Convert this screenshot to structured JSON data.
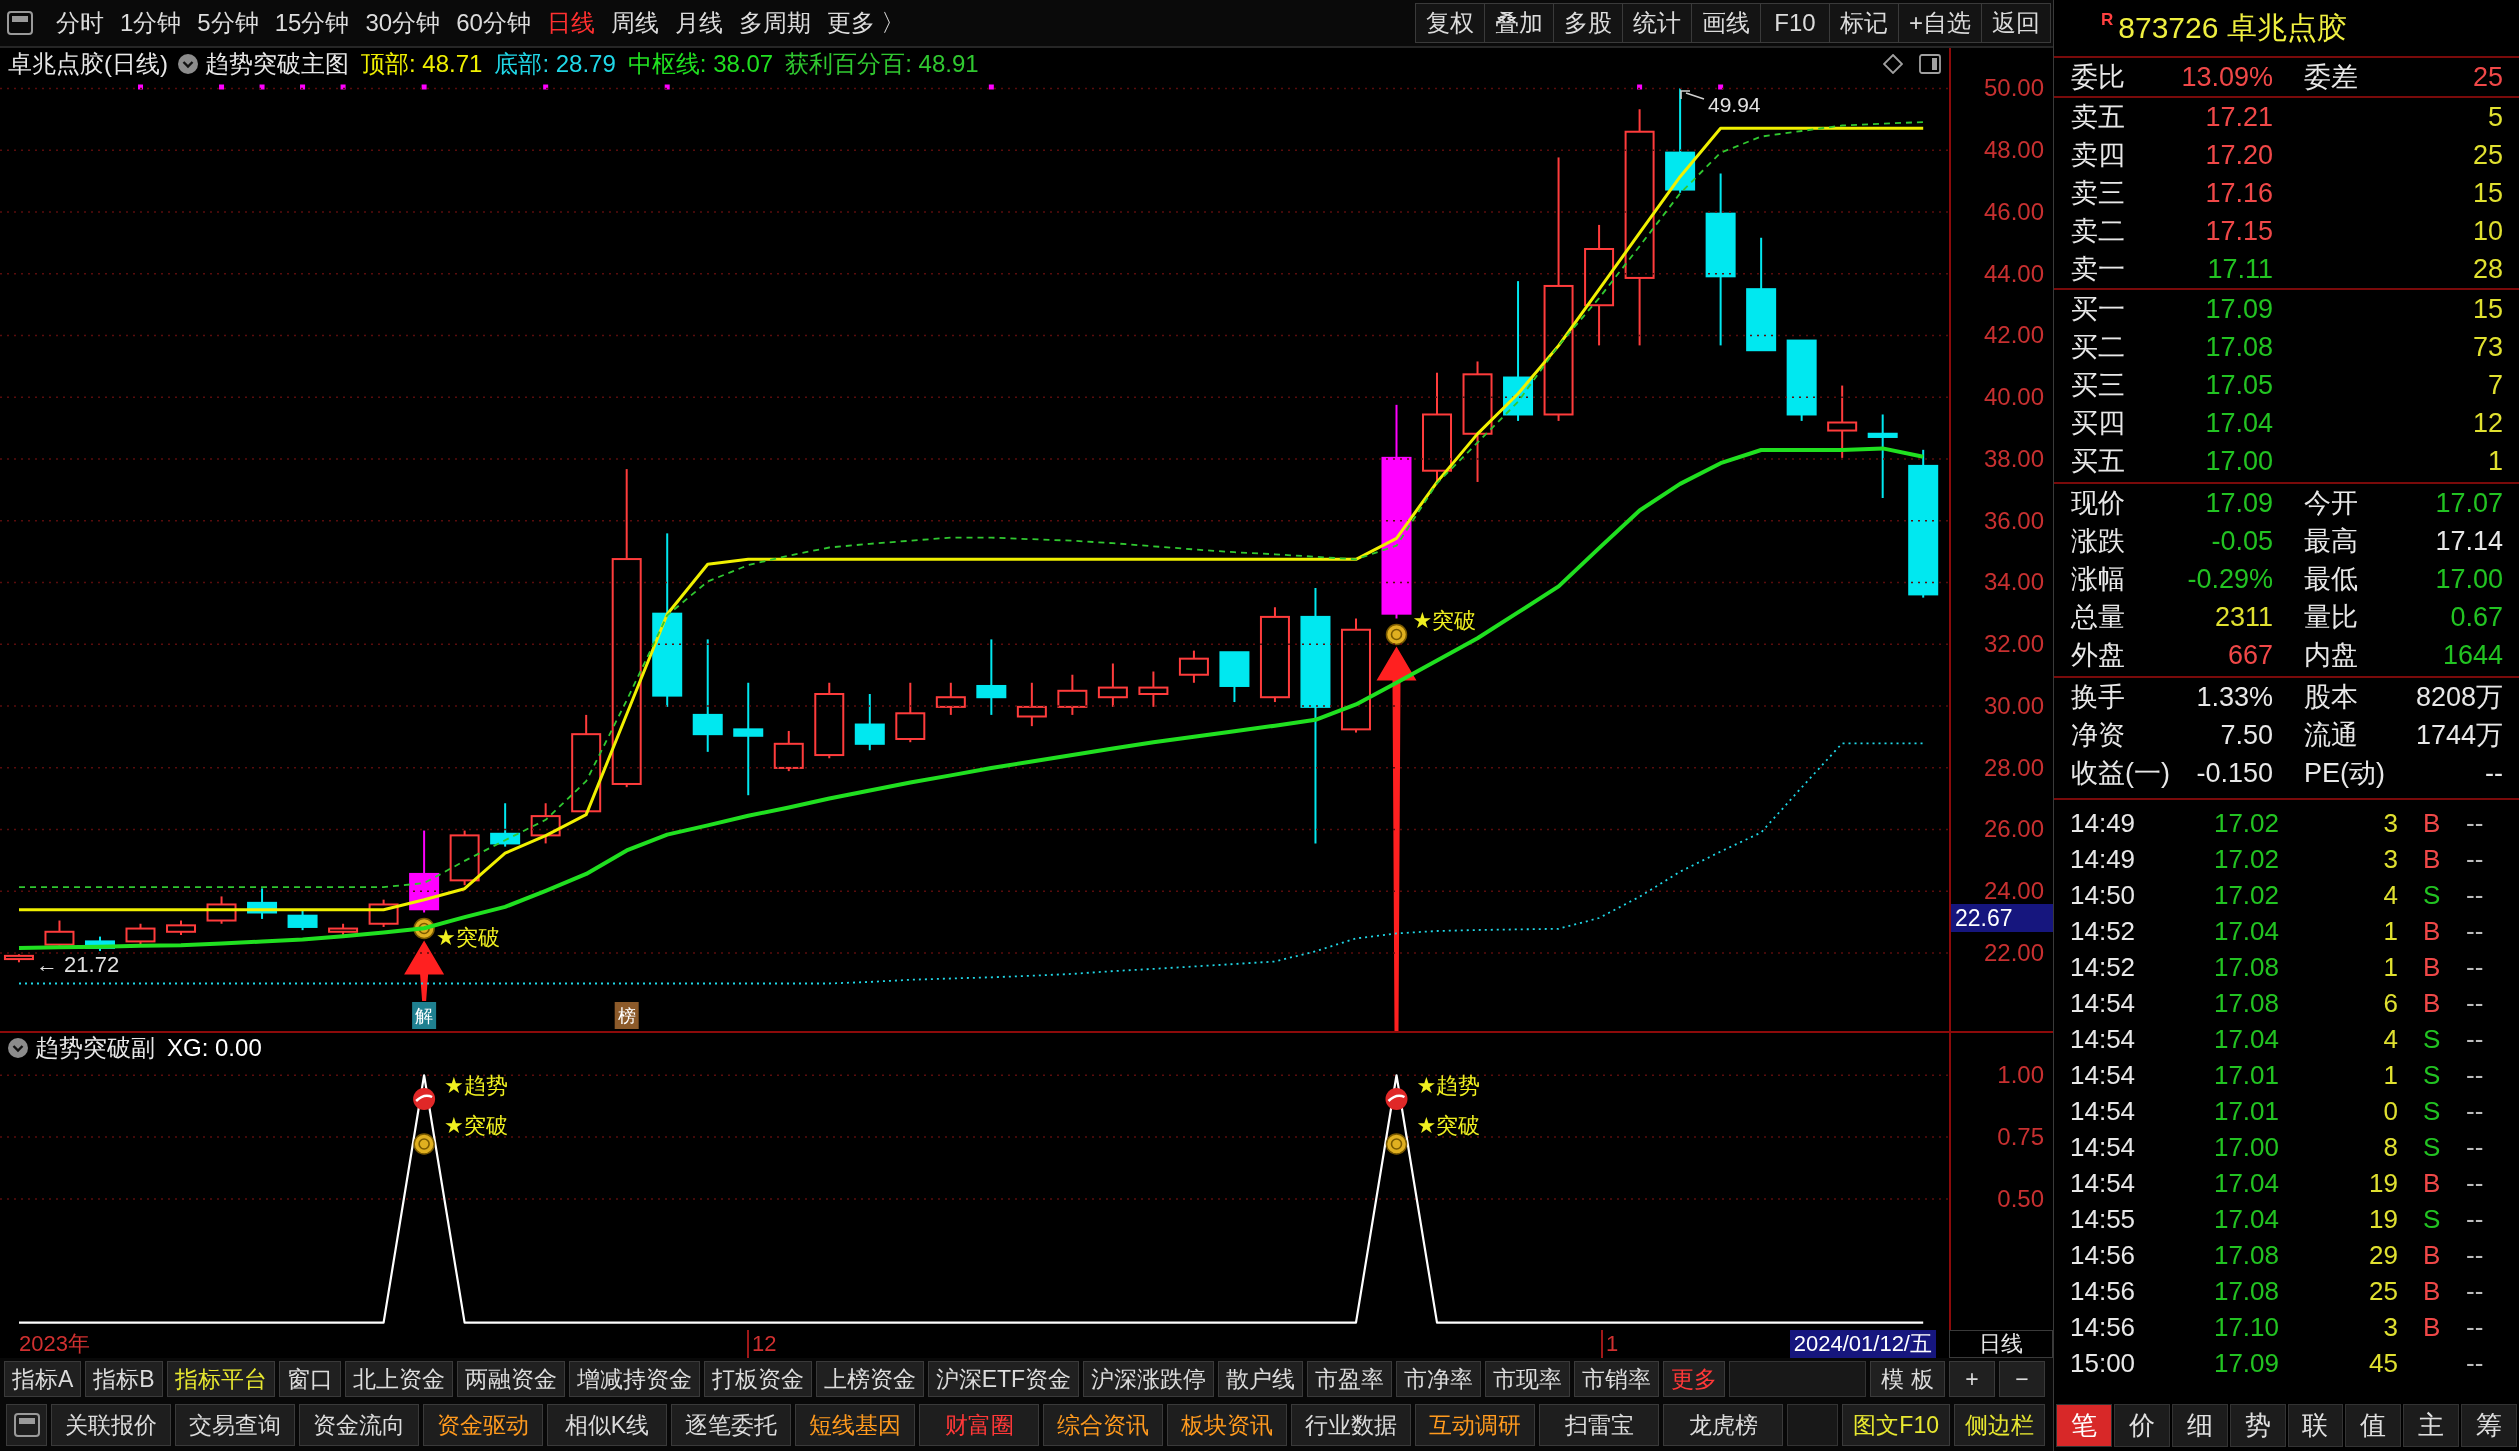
{
  "toolbar": {
    "periods": [
      {
        "label": "分时",
        "selected": false
      },
      {
        "label": "1分钟",
        "selected": false
      },
      {
        "label": "5分钟",
        "selected": false
      },
      {
        "label": "15分钟",
        "selected": false
      },
      {
        "label": "30分钟",
        "selected": false
      },
      {
        "label": "60分钟",
        "selected": false
      },
      {
        "label": "日线",
        "selected": true
      },
      {
        "label": "周线",
        "selected": false
      },
      {
        "label": "月线",
        "selected": false
      },
      {
        "label": "多周期",
        "selected": false
      },
      {
        "label": "更多 〉",
        "selected": false
      }
    ],
    "actions": [
      "复权",
      "叠加",
      "多股",
      "统计",
      "画线",
      "F10",
      "标记",
      "+自选",
      "返回"
    ]
  },
  "main_chart": {
    "title": "卓兆点胶(日线)",
    "indicator": "趋势突破主图",
    "readouts": [
      ": 48.71",
      ": 28.79",
      ": 38.07",
      ": 48.91"
    ],
    "high_label": "49.94",
    "low_label": "← 21.72",
    "signals": [
      "★突破",
      "★突破"
    ],
    "tags": [
      {
        "label": "解",
        "color": "#1f8090"
      },
      {
        "label": "榜",
        "color": "#8c5a2a"
      }
    ],
    "price_tag": "22.67",
    "chart_data": {
      "type": "line",
      "series": [
        {
          "name": "顶部",
          "color": "#f0f000",
          "values": [
            23.4,
            23.4,
            23.4,
            23.4,
            23.4,
            23.4,
            23.4,
            23.4,
            23.4,
            23.4,
            23.72,
            24.08,
            25.23,
            25.8,
            26.48,
            29.73,
            32.97,
            34.59,
            34.75,
            34.75,
            34.75,
            34.75,
            34.75,
            34.75,
            34.75,
            34.75,
            34.75,
            34.75,
            34.75,
            34.75,
            34.75,
            34.75,
            34.75,
            34.75,
            35.43,
            37.25,
            38.81,
            40.11,
            41.67,
            43.49,
            45.32,
            47.14,
            48.71,
            48.71,
            48.71,
            48.71,
            48.71,
            48.71
          ]
        },
        {
          "name": "底部",
          "color": "#20d8e8",
          "line_style": "dotted",
          "values": [
            21.01,
            21.01,
            21.01,
            21.01,
            21.01,
            21.01,
            21.01,
            21.01,
            21.01,
            21.01,
            21.01,
            21.01,
            21.01,
            21.01,
            21.01,
            21.01,
            21.01,
            21.01,
            21.01,
            21.01,
            21.01,
            21.06,
            21.13,
            21.17,
            21.21,
            21.26,
            21.32,
            21.41,
            21.48,
            21.56,
            21.64,
            21.72,
            22.05,
            22.47,
            22.63,
            22.71,
            22.74,
            22.76,
            22.78,
            23.13,
            23.82,
            24.63,
            25.28,
            25.9,
            27.36,
            28.79,
            28.79,
            28.79
          ]
        },
        {
          "name": "中枢线",
          "color": "#20e020",
          "values": [
            22.16,
            22.18,
            22.2,
            22.23,
            22.25,
            22.3,
            22.37,
            22.43,
            22.54,
            22.66,
            22.8,
            23.16,
            23.49,
            24.01,
            24.56,
            25.32,
            25.83,
            26.13,
            26.44,
            26.71,
            27.0,
            27.26,
            27.52,
            27.75,
            27.99,
            28.2,
            28.41,
            28.62,
            28.82,
            29.0,
            29.18,
            29.36,
            29.55,
            30.05,
            30.75,
            31.47,
            32.19,
            33.03,
            33.87,
            35.11,
            36.33,
            37.19,
            37.86,
            38.29,
            38.29,
            38.29,
            38.34,
            38.07
          ]
        },
        {
          "name": "获利百分百",
          "color": "#30c830",
          "line_style": "dashed",
          "values": [
            24.13,
            24.13,
            24.13,
            24.13,
            24.13,
            24.13,
            24.13,
            24.13,
            24.13,
            24.13,
            24.26,
            24.98,
            25.65,
            26.31,
            27.56,
            30.18,
            32.93,
            34.03,
            34.56,
            34.87,
            35.13,
            35.25,
            35.35,
            35.45,
            35.45,
            35.4,
            35.35,
            35.27,
            35.17,
            35.07,
            34.98,
            34.91,
            34.83,
            34.75,
            35.19,
            37.21,
            38.53,
            39.85,
            41.67,
            43.21,
            44.89,
            46.6,
            47.92,
            48.44,
            48.62,
            48.8,
            48.86,
            48.91
          ]
        }
      ],
      "ylim": [
        19.47,
        51.31
      ],
      "grid": true,
      "yticks": [
        {
          "value": 50,
          "label": "50.00"
        },
        {
          "value": 48,
          "label": "48.00"
        },
        {
          "value": 46,
          "label": "46.00"
        },
        {
          "value": 44,
          "label": "44.00"
        },
        {
          "value": 42,
          "label": "42.00"
        },
        {
          "value": 40,
          "label": "40.00"
        },
        {
          "value": 38,
          "label": "38.00"
        },
        {
          "value": 36,
          "label": "36.00"
        },
        {
          "value": 34,
          "label": "34.00"
        },
        {
          "value": 32,
          "label": "32.00"
        },
        {
          "value": 30,
          "label": "30.00"
        },
        {
          "value": 28,
          "label": "28.00"
        },
        {
          "value": 26,
          "label": "26.00"
        },
        {
          "value": 24,
          "label": "24.00"
        },
        {
          "value": 22,
          "label": "22.00"
        }
      ]
    }
  },
  "sub_chart": {
    "indicator": "趋势突破副",
    "readout": ": 0.00",
    "signals": [
      {
        "trend": "★趋势",
        "breakout": "★突破"
      },
      {
        "trend": "★趋势",
        "breakout": "★突破"
      }
    ],
    "chart_data": {
      "type": "line",
      "series": [
        {
          "name": "XG",
          "color": "#ffffff",
          "values": [
            0,
            0,
            0,
            0,
            0,
            0,
            0,
            0,
            0,
            0,
            1,
            0,
            0,
            0,
            0,
            0,
            0,
            0,
            0,
            0,
            0,
            0,
            0,
            0,
            0,
            0,
            0,
            0,
            0,
            0,
            0,
            0,
            0,
            0,
            1,
            0,
            0,
            0,
            0,
            0,
            0,
            0,
            0,
            0,
            0,
            0,
            0,
            0
          ]
        }
      ],
      "ylim": [
        -0.03,
        1.171
      ],
      "grid": true,
      "yticks": [
        {
          "value": 1,
          "label": "1.00"
        },
        {
          "value": 0.75,
          "label": "0.75"
        },
        {
          "value": 0.5,
          "label": "0.50"
        }
      ]
    }
  },
  "date_axis": {
    "labels": [
      "2023年",
      "12",
      "1"
    ],
    "cursor_date": "2024/01/12/五",
    "period": "日线"
  },
  "indicator_tabs": [
    {
      "label": "指标A",
      "color": "#dcdcdc"
    },
    {
      "label": "指标B",
      "color": "#dcdcdc"
    },
    {
      "label": "指标平台",
      "color": "#e8e830"
    },
    {
      "label": "窗口",
      "color": "#dcdcdc"
    },
    {
      "label": "北上资金",
      "color": "#dcdcdc"
    },
    {
      "label": "两融资金",
      "color": "#dcdcdc"
    },
    {
      "label": "增减持资金",
      "color": "#dcdcdc"
    },
    {
      "label": "打板资金",
      "color": "#dcdcdc"
    },
    {
      "label": "上榜资金",
      "color": "#dcdcdc"
    },
    {
      "label": "沪深ETF资金",
      "color": "#dcdcdc"
    },
    {
      "label": "沪深涨跌停",
      "color": "#dcdcdc"
    },
    {
      "label": "散户线",
      "color": "#dcdcdc"
    },
    {
      "label": "市盈率",
      "color": "#dcdcdc"
    },
    {
      "label": "市净率",
      "color": "#dcdcdc"
    },
    {
      "label": "市现率",
      "color": "#dcdcdc"
    },
    {
      "label": "市销率",
      "color": "#dcdcdc"
    },
    {
      "label": "更多",
      "color": "#ff3838"
    }
  ],
  "indicator_tools": [
    "模 板",
    "+",
    "−"
  ],
  "function_tabs": [
    {
      "label": "关联报价",
      "color": "#dcdcdc"
    },
    {
      "label": "交易查询",
      "color": "#dcdcdc"
    },
    {
      "label": "资金流向",
      "color": "#dcdcdc"
    },
    {
      "label": "资金驱动",
      "color": "#ff9a1e"
    },
    {
      "label": "相似K线",
      "color": "#dcdcdc"
    },
    {
      "label": "逐笔委托",
      "color": "#dcdcdc"
    },
    {
      "label": "短线基因",
      "color": "#ff9a1e"
    },
    {
      "label": "财富圈",
      "color": "#ff3838"
    },
    {
      "label": "综合资讯",
      "color": "#ff9a1e"
    },
    {
      "label": "板块资讯",
      "color": "#ff9a1e"
    },
    {
      "label": "行业数据",
      "color": "#dcdcdc"
    },
    {
      "label": "互动调研",
      "color": "#ff9a1e"
    },
    {
      "label": "扫雷宝",
      "color": "#dcdcdc"
    },
    {
      "label": "龙虎榜",
      "color": "#dcdcdc"
    }
  ],
  "side_tabs": [
    {
      "label": "图文F10",
      "color": "#e8e830"
    },
    {
      "label": "侧边栏",
      "color": "#e8e830"
    }
  ],
  "quote_panel": {
    "flag": "R",
    "title": "873726 卓兆点胶",
    "ratio": [
      {
        "label": "委比",
        "value": "13.09%",
        "color": "#f04848"
      },
      {
        "label": "委差",
        "value": "25",
        "color": "#f04848"
      }
    ],
    "asks": [
      {
        "label": "卖五",
        "price": "17.21",
        "volume": "5",
        "color": "#f04848"
      },
      {
        "label": "卖四",
        "price": "17.20",
        "volume": "25",
        "color": "#f04848"
      },
      {
        "label": "卖三",
        "price": "17.16",
        "volume": "15",
        "color": "#f04848"
      },
      {
        "label": "卖二",
        "price": "17.15",
        "volume": "10",
        "color": "#f04848"
      },
      {
        "label": "卖一",
        "price": "17.11",
        "volume": "28",
        "color": "#22c322"
      }
    ],
    "bids": [
      {
        "label": "买一",
        "price": "17.09",
        "volume": "15",
        "color": "#22c322"
      },
      {
        "label": "买二",
        "price": "17.08",
        "volume": "73",
        "color": "#22c322"
      },
      {
        "label": "买三",
        "price": "17.05",
        "volume": "7",
        "color": "#22c322"
      },
      {
        "label": "买四",
        "price": "17.04",
        "volume": "12",
        "color": "#22c322"
      },
      {
        "label": "买五",
        "price": "17.00",
        "volume": "1",
        "color": "#22c322"
      }
    ],
    "stats": [
      {
        "label": "现价",
        "value": "17.09",
        "color": "#22c322"
      },
      {
        "label": "今开",
        "value": "17.07",
        "color": "#22c322"
      },
      {
        "label": "涨跌",
        "value": "-0.05",
        "color": "#22c322"
      },
      {
        "label": "最高",
        "value": "17.14",
        "color": "#e8e8e8"
      },
      {
        "label": "涨幅",
        "value": "-0.29%",
        "color": "#22c322"
      },
      {
        "label": "最低",
        "value": "17.00",
        "color": "#22c322"
      },
      {
        "label": "总量",
        "value": "2311",
        "color": "#e0e030"
      },
      {
        "label": "量比",
        "value": "0.67",
        "color": "#22c322"
      },
      {
        "label": "外盘",
        "value": "667",
        "color": "#f04848"
      },
      {
        "label": "内盘",
        "value": "1644",
        "color": "#22c322"
      }
    ],
    "fundamentals": [
      {
        "label": "换手",
        "value": "1.33%"
      },
      {
        "label": "股本",
        "value": "8208万"
      },
      {
        "label": "净资",
        "value": "7.50"
      },
      {
        "label": "流通",
        "value": "1744万"
      },
      {
        "label": "收益(一)",
        "value": "-0.150"
      },
      {
        "label": "PE(动)",
        "value": "--"
      }
    ],
    "ticks": [
      {
        "time": "14:49",
        "price": "17.02",
        "volume": "3",
        "side": "B",
        "color": "#f04848",
        "change": "--"
      },
      {
        "time": "14:49",
        "price": "17.02",
        "volume": "3",
        "side": "B",
        "color": "#f04848",
        "change": "--"
      },
      {
        "time": "14:50",
        "price": "17.02",
        "volume": "4",
        "side": "S",
        "color": "#22c322",
        "change": "--"
      },
      {
        "time": "14:52",
        "price": "17.04",
        "volume": "1",
        "side": "B",
        "color": "#f04848",
        "change": "--"
      },
      {
        "time": "14:52",
        "price": "17.08",
        "volume": "1",
        "side": "B",
        "color": "#f04848",
        "change": "--"
      },
      {
        "time": "14:54",
        "price": "17.08",
        "volume": "6",
        "side": "B",
        "color": "#f04848",
        "change": "--"
      },
      {
        "time": "14:54",
        "price": "17.04",
        "volume": "4",
        "side": "S",
        "color": "#22c322",
        "change": "--"
      },
      {
        "time": "14:54",
        "price": "17.01",
        "volume": "1",
        "side": "S",
        "color": "#22c322",
        "change": "--"
      },
      {
        "time": "14:54",
        "price": "17.01",
        "volume": "0",
        "side": "S",
        "color": "#22c322",
        "change": "--"
      },
      {
        "time": "14:54",
        "price": "17.00",
        "volume": "8",
        "side": "S",
        "color": "#22c322",
        "change": "--"
      },
      {
        "time": "14:54",
        "price": "17.04",
        "volume": "19",
        "side": "B",
        "color": "#f04848",
        "change": "--"
      },
      {
        "time": "14:55",
        "price": "17.04",
        "volume": "19",
        "side": "S",
        "color": "#22c322",
        "change": "--"
      },
      {
        "time": "14:56",
        "price": "17.08",
        "volume": "29",
        "side": "B",
        "color": "#f04848",
        "change": "--"
      },
      {
        "time": "14:56",
        "price": "17.08",
        "volume": "25",
        "side": "B",
        "color": "#f04848",
        "change": "--"
      },
      {
        "time": "14:56",
        "price": "17.10",
        "volume": "3",
        "side": "B",
        "color": "#f04848",
        "change": "--"
      },
      {
        "time": "15:00",
        "price": "17.09",
        "volume": "45",
        "change": "--"
      }
    ],
    "tabs": [
      {
        "label": "笔",
        "selected": true
      },
      {
        "label": "价",
        "selected": false
      },
      {
        "label": "细",
        "selected": false
      },
      {
        "label": "势",
        "selected": false
      },
      {
        "label": "联",
        "selected": false
      },
      {
        "label": "值",
        "selected": false
      },
      {
        "label": "主",
        "selected": false
      },
      {
        "label": "筹",
        "selected": false
      }
    ]
  }
}
